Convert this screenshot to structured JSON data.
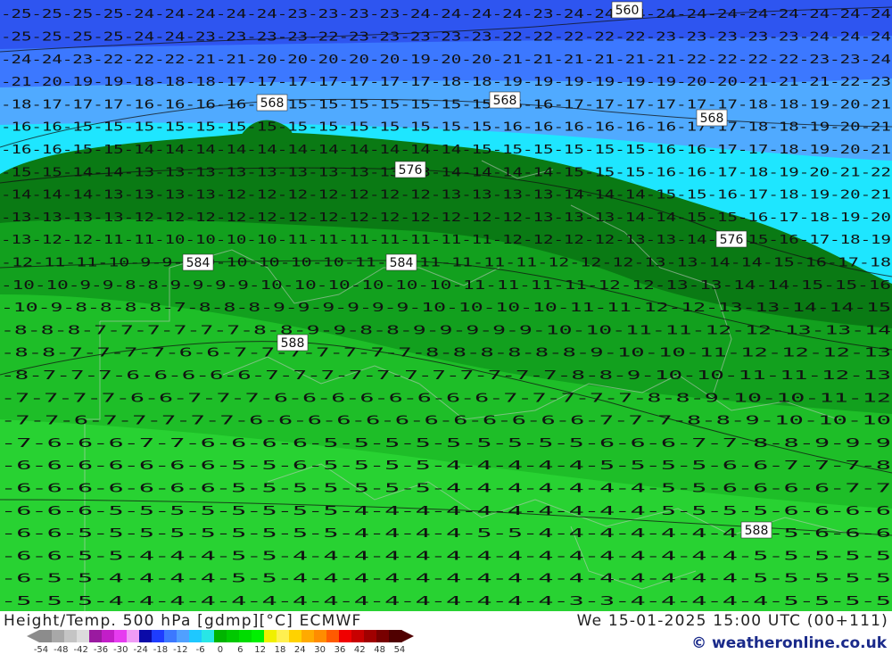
{
  "map": {
    "title": "Height/Temp. 500 hPa [gdmp][°C] ECMWF",
    "datetime": "We 15-01-2025 15:00 UTC (00+111)",
    "copyright": "© weatheronline.co.uk",
    "contour_labels": [
      "560",
      "568",
      "568",
      "568",
      "576",
      "576",
      "584",
      "584",
      "588",
      "588"
    ],
    "temperature_rows": [
      "-25-25-25-25-24-24-24-24-24-23-23-23-23-24-24-24-24-23-24-24-24-24-24-24-24-24-24-24-24",
      "-25-25-25-25-24-24-23-23-23-23-22-23-23-23-23-23-22-22-22-22-22-23-23-23-23-23-24-24-24",
      "-24-24-23-22-22-22-21-21-20-20-20-20-20-19-20-20-21-21-21-21-21-21-22-22-22-22-23-23-24",
      "-21-20-19-19-18-18-18-17-17-17-17-17-17-17-18-18-19-19-19-19-19-19-20-20-21-21-21-22-23",
      "-18-17-17-17-16-16-16-16-15-15-15-15-15-15-15-15-16-16-17-17-17-17-17-17-18-18-19-20-21",
      "-16-16-15-15-15-15-15-15-15-15-15-15-15-15-15-15-16-16-16-16-16-16-17-17-18-18-19-20-21",
      "-16-16-15-15-14-14-14-14-14-14-14-14-14-14-14-15-15-15-15-15-15-16-16-17-17-18-19-20-21",
      "-15-15-14-14-13-13-13-13-13-13-13-13-13-13-14-14-14-14-15-15-15-16-16-17-18-19-20-21-22",
      "-14-14-14-13-13-13-13-12-12-12-12-12-12-12-13-13-13-13-14-14-14-15-15-16-17-18-19-20-21",
      "-13-13-13-13-12-12-12-12-12-12-12-12-12-12-12-12-12-13-13-13-14-14-15-15-16-17-18-19-20",
      "-13-12-12-11-11-10-10-10-10-11-11-11-11-11-11-11-12-12-12-12-13-13-14-14-15-16-17-18-19",
      "-12-11-11-10-9-9-9-9-10-10-10-10-11-11-11-11-11-11-12-12-12-13-13-14-14-15-16-17-18",
      "-10-10-9-9-8-8-9-9-9-9-10-10-10-10-10-10-11-11-11-11-12-12-13-13-14-14-15-15-16",
      "-10-9-8-8-8-8-7-8-8-8-9-9-9-9-9-9-10-10-10-10-11-11-12-12-13-13-14-14-15",
      "-8-8-8-7-7-7-7-7-7-8-8-9-9-8-8-9-9-9-9-9-10-10-11-11-12-12-13-13-14",
      "-8-8-7-7-7-7-6-6-7-7-7-7-7-7-7-8-8-8-8-8-8-9-10-10-11-12-12-12-13",
      "-8-7-7-7-6-6-6-6-6-7-7-7-7-7-7-7-7-7-7-7-8-8-9-10-10-11-11-12-13",
      "-7-7-7-7-6-6-7-7-7-6-6-6-6-6-6-6-6-7-7-7-7-7-8-8-9-10-10-11-12",
      "-7-7-6-7-7-7-7-7-6-6-6-6-6-6-6-6-6-6-6-6-7-7-7-8-8-9-10-10-10",
      "-7-6-6-6-7-7-6-6-6-6-5-5-5-5-5-5-5-5-5-6-6-6-7-7-8-8-9-9-9",
      "-6-6-6-6-6-6-6-5-5-6-5-5-5-5-4-4-4-4-4-5-5-5-5-6-6-7-7-7-8",
      "-6-6-6-6-6-6-6-5-5-5-5-5-5-5-4-4-4-4-4-4-4-5-5-6-6-6-6-7-7",
      "-6-6-6-5-5-5-5-5-5-5-5-4-4-4-4-4-4-4-4-4-4-5-5-5-5-6-6-6-6",
      "-6-6-5-5-5-5-5-5-5-5-5-4-4-4-4-5-5-4-4-4-4-4-4-4-5-5-6-6-6",
      "-6-6-5-5-4-4-4-5-5-4-4-4-4-4-4-4-4-4-4-4-4-4-4-4-5-5-5-5-5",
      "-6-5-5-4-4-4-4-5-5-4-4-4-4-4-4-4-4-4-4-4-4-4-4-4-5-5-5-5-5",
      "-5-5-5-4-4-4-4-4-4-4-4-4-4-4-4-4-4-4-3-3-4-4-4-4-4-5-5-5-5"
    ]
  },
  "legend": {
    "tick_labels": [
      "-54",
      "-48",
      "-42",
      "-36",
      "-30",
      "-24",
      "-18",
      "-12",
      "-6",
      "0",
      "6",
      "12",
      "18",
      "24",
      "30",
      "36",
      "42",
      "48",
      "54"
    ],
    "colors": [
      "#8c8c8c",
      "#a8a8a8",
      "#c4c4c4",
      "#dcdcdc",
      "#9a1aa0",
      "#c21ec8",
      "#e63cf0",
      "#f09cf6",
      "#0a0aa8",
      "#1e3cff",
      "#3c78ff",
      "#50a0ff",
      "#1ec8ff",
      "#28e6e6",
      "#00b400",
      "#00c800",
      "#00dc00",
      "#00f000",
      "#f0f000",
      "#fff050",
      "#ffd200",
      "#ffaa00",
      "#ff8c00",
      "#ff5a00",
      "#f00000",
      "#c80000",
      "#a00000",
      "#780000",
      "#500000"
    ]
  },
  "palette": {
    "blue_dark": "#2e55f0",
    "blue": "#3c78ff",
    "sky": "#50aaff",
    "cyan": "#1ee6ff",
    "green_dark": "#0a7a14",
    "green": "#12a01e",
    "green_light": "#1ebe28",
    "green_bright": "#28d232"
  }
}
